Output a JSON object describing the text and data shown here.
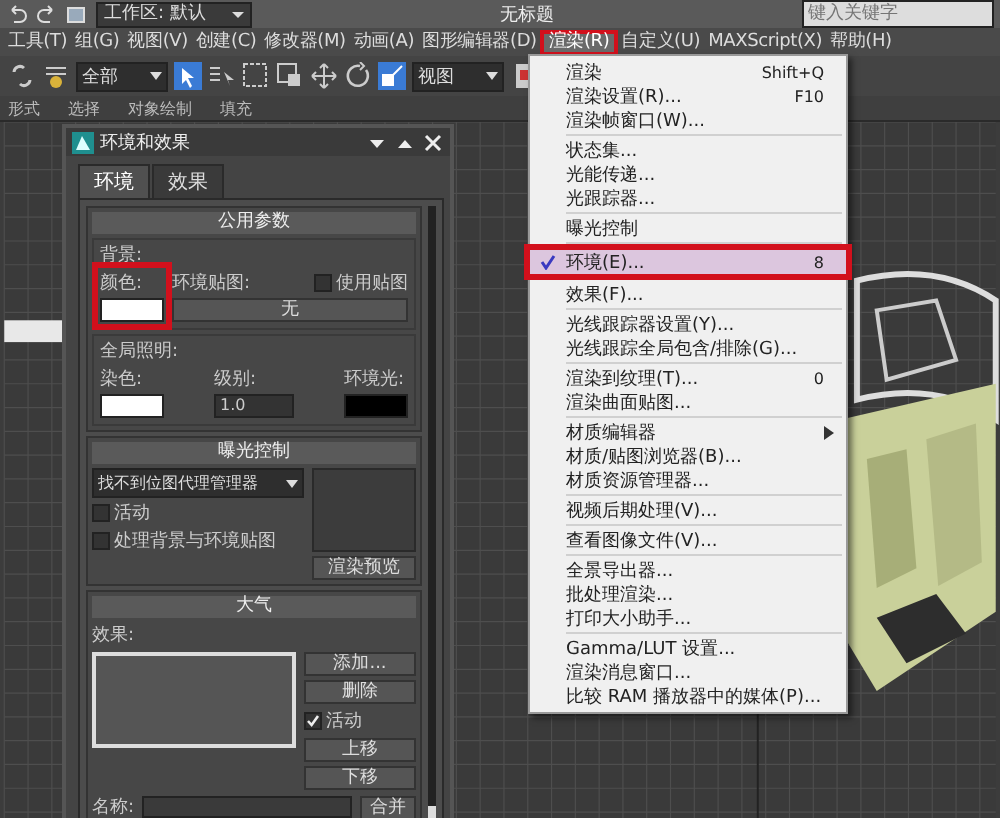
{
  "title_bar": {
    "workspace": "工作区: 默认",
    "title": "无标题",
    "search_placeholder": "键入关键字"
  },
  "menu_bar": [
    {
      "label": "工具(T)",
      "selected": false,
      "annotated": false
    },
    {
      "label": "组(G)",
      "selected": false,
      "annotated": false
    },
    {
      "label": "视图(V)",
      "selected": false,
      "annotated": false
    },
    {
      "label": "创建(C)",
      "selected": false,
      "annotated": false
    },
    {
      "label": "修改器(M)",
      "selected": false,
      "annotated": false
    },
    {
      "label": "动画(A)",
      "selected": false,
      "annotated": false
    },
    {
      "label": "图形编辑器(D)",
      "selected": false,
      "annotated": false
    },
    {
      "label": "渲染(R)",
      "selected": true,
      "annotated": true
    },
    {
      "label": "自定义(U)",
      "selected": false,
      "annotated": false
    },
    {
      "label": "MAXScript(X)",
      "selected": false,
      "annotated": false
    },
    {
      "label": "帮助(H)",
      "selected": false,
      "annotated": false
    }
  ],
  "toolbar": {
    "selection_filter": "全部",
    "reference_system": "视图"
  },
  "ribbon_tabs": [
    {
      "label": "形式"
    },
    {
      "label": "选择"
    },
    {
      "label": "对象绘制"
    },
    {
      "label": "填充"
    }
  ],
  "dialog": {
    "title": "环境和效果",
    "tabs": [
      {
        "label": "环境",
        "selected": true
      },
      {
        "label": "效果",
        "selected": false
      }
    ],
    "common": {
      "title": "公用参数",
      "background_label": "背景:",
      "color_label": "颜色:",
      "color_annotated": true,
      "map_label": "环境贴图:",
      "map_button": "无",
      "use_map": {
        "label": "使用贴图",
        "checked": false
      },
      "gi_label": "全局照明:",
      "tint_label": "染色:",
      "level_label": "级别:",
      "level_value": "1.0",
      "ambient_label": "环境光:"
    },
    "exposure": {
      "title": "曝光控制",
      "dropdown": "找不到位图代理管理器",
      "active": {
        "label": "活动",
        "checked": false
      },
      "process_bg": {
        "label": "处理背景与环境贴图",
        "checked": false
      },
      "preview_button": "渲染预览"
    },
    "atmosphere": {
      "title": "大气",
      "effects_label": "效果:",
      "add": "添加...",
      "delete": "删除",
      "active": {
        "label": "活动",
        "checked": true
      },
      "move_up": "上移",
      "move_down": "下移",
      "name_label": "名称:",
      "merge": "合并"
    }
  },
  "menu": [
    {
      "kind": "item",
      "label": "渲染",
      "shortcut": "Shift+Q",
      "selected": false,
      "checked": false,
      "annotated": false,
      "submenu": false
    },
    {
      "kind": "item",
      "label": "渲染设置(R)...",
      "shortcut": "F10",
      "selected": false,
      "checked": false,
      "annotated": false,
      "submenu": false
    },
    {
      "kind": "item",
      "label": "渲染帧窗口(W)...",
      "selected": false,
      "checked": false,
      "annotated": false,
      "submenu": false
    },
    {
      "kind": "separator"
    },
    {
      "kind": "item",
      "label": "状态集...",
      "selected": false,
      "checked": false,
      "annotated": false,
      "submenu": false
    },
    {
      "kind": "item",
      "label": "光能传递...",
      "selected": false,
      "checked": false,
      "annotated": false,
      "submenu": false
    },
    {
      "kind": "item",
      "label": "光跟踪器...",
      "selected": false,
      "checked": false,
      "annotated": false,
      "submenu": false
    },
    {
      "kind": "separator"
    },
    {
      "kind": "item",
      "label": "曝光控制",
      "selected": false,
      "checked": false,
      "annotated": false,
      "submenu": false
    },
    {
      "kind": "separator"
    },
    {
      "kind": "item",
      "label": "环境(E)...",
      "shortcut": "8",
      "selected": true,
      "checked": true,
      "annotated": true,
      "submenu": false
    },
    {
      "kind": "item",
      "label": "效果(F)...",
      "selected": false,
      "checked": false,
      "annotated": false,
      "submenu": false
    },
    {
      "kind": "separator"
    },
    {
      "kind": "item",
      "label": "光线跟踪器设置(Y)...",
      "selected": false,
      "checked": false,
      "annotated": false,
      "submenu": false
    },
    {
      "kind": "item",
      "label": "光线跟踪全局包含/排除(G)...",
      "selected": false,
      "checked": false,
      "annotated": false,
      "submenu": false
    },
    {
      "kind": "separator"
    },
    {
      "kind": "item",
      "label": "渲染到纹理(T)...",
      "shortcut": "0",
      "selected": false,
      "checked": false,
      "annotated": false,
      "submenu": false
    },
    {
      "kind": "item",
      "label": "渲染曲面贴图...",
      "selected": false,
      "checked": false,
      "annotated": false,
      "submenu": false
    },
    {
      "kind": "separator"
    },
    {
      "kind": "item",
      "label": "材质编辑器",
      "selected": false,
      "checked": false,
      "annotated": false,
      "submenu": true
    },
    {
      "kind": "item",
      "label": "材质/贴图浏览器(B)...",
      "selected": false,
      "checked": false,
      "annotated": false,
      "submenu": false
    },
    {
      "kind": "item",
      "label": "材质资源管理器...",
      "selected": false,
      "checked": false,
      "annotated": false,
      "submenu": false
    },
    {
      "kind": "separator"
    },
    {
      "kind": "item",
      "label": "视频后期处理(V)...",
      "selected": false,
      "checked": false,
      "annotated": false,
      "submenu": false
    },
    {
      "kind": "separator"
    },
    {
      "kind": "item",
      "label": "查看图像文件(V)...",
      "selected": false,
      "checked": false,
      "annotated": false,
      "submenu": false
    },
    {
      "kind": "separator"
    },
    {
      "kind": "item",
      "label": "全景导出器...",
      "selected": false,
      "checked": false,
      "annotated": false,
      "submenu": false
    },
    {
      "kind": "item",
      "label": "批处理渲染...",
      "selected": false,
      "checked": false,
      "annotated": false,
      "submenu": false
    },
    {
      "kind": "item",
      "label": "打印大小助手...",
      "selected": false,
      "checked": false,
      "annotated": false,
      "submenu": false
    },
    {
      "kind": "separator"
    },
    {
      "kind": "item",
      "label": "Gamma/LUT 设置...",
      "selected": false,
      "checked": false,
      "annotated": false,
      "submenu": false
    },
    {
      "kind": "item",
      "label": "渲染消息窗口...",
      "selected": false,
      "checked": false,
      "annotated": false,
      "submenu": false
    },
    {
      "kind": "item",
      "label": "比较 RAM 播放器中的媒体(P)...",
      "selected": false,
      "checked": false,
      "annotated": false,
      "submenu": false
    }
  ]
}
